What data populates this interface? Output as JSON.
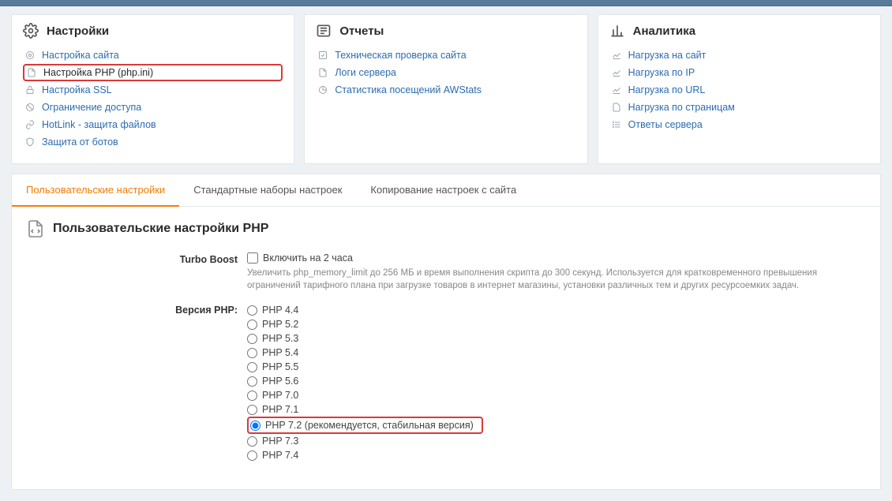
{
  "panels": {
    "settings": {
      "title": "Настройки",
      "items": [
        {
          "label": "Настройка сайта"
        },
        {
          "label": "Настройка PHP (php.ini)",
          "selected": true
        },
        {
          "label": "Настройка SSL"
        },
        {
          "label": "Ограничение доступа"
        },
        {
          "label": "HotLink - защита файлов"
        },
        {
          "label": "Защита от ботов"
        }
      ]
    },
    "reports": {
      "title": "Отчеты",
      "items": [
        {
          "label": "Техническая проверка сайта"
        },
        {
          "label": "Логи сервера"
        },
        {
          "label": "Статистика посещений AWStats"
        }
      ]
    },
    "analytics": {
      "title": "Аналитика",
      "items": [
        {
          "label": "Нагрузка на сайт"
        },
        {
          "label": "Нагрузка по IP"
        },
        {
          "label": "Нагрузка по URL"
        },
        {
          "label": "Нагрузка по страницам"
        },
        {
          "label": "Ответы сервера"
        }
      ]
    }
  },
  "tabs": {
    "t0": "Пользовательские настройки",
    "t1": "Стандартные наборы настроек",
    "t2": "Копирование настроек с сайта"
  },
  "content": {
    "title": "Пользовательские настройки PHP",
    "turbo": {
      "label": "Turbo Boost",
      "checkbox_label": "Включить на 2 часа",
      "hint": "Увеличить php_memory_limit до 256 МБ и время выполнения скрипта до 300 секунд. Используется для кратковременного превышения ограничений тарифного плана при загрузке товаров в интернет магазины, установки различных тем и других ресурсоемких задач."
    },
    "php": {
      "label": "Версия PHP:",
      "options": {
        "v0": "PHP 4.4",
        "v1": "PHP 5.2",
        "v2": "PHP 5.3",
        "v3": "PHP 5.4",
        "v4": "PHP 5.5",
        "v5": "PHP 5.6",
        "v6": "PHP 7.0",
        "v7": "PHP 7.1",
        "v8": "PHP 7.2 (рекомендуется, стабильная версия)",
        "v9": "PHP 7.3",
        "v10": "PHP 7.4"
      },
      "selected": "v8",
      "highlight": "v8"
    }
  }
}
